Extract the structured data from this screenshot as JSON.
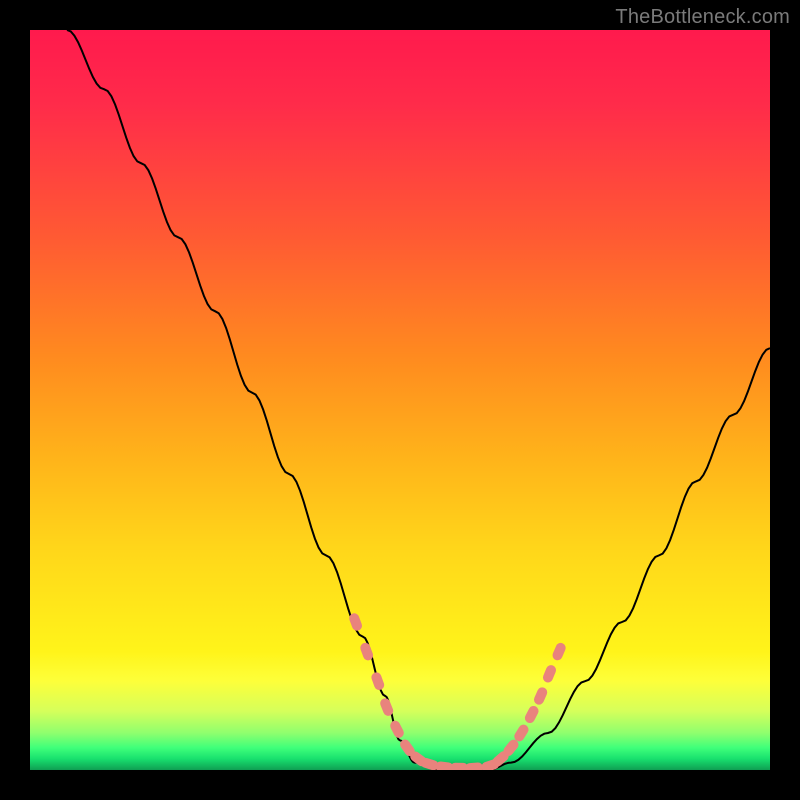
{
  "watermark": "TheBottleneck.com",
  "colors": {
    "background": "#000000",
    "gradient_top": "#ff1a4d",
    "gradient_mid": "#ffd61a",
    "gradient_bottom": "#0f9e52",
    "curve": "#000000",
    "dots": "#e9837d",
    "watermark_text": "#7a7a7a"
  },
  "chart_data": {
    "type": "line",
    "title": "",
    "xlabel": "",
    "ylabel": "",
    "xlim": [
      0,
      100
    ],
    "ylim": [
      0,
      100
    ],
    "series": [
      {
        "name": "bottleneck-curve",
        "x": [
          5,
          10,
          15,
          20,
          25,
          30,
          35,
          40,
          45,
          48,
          50,
          52,
          55,
          58,
          60,
          62,
          65,
          70,
          75,
          80,
          85,
          90,
          95,
          100
        ],
        "values": [
          100,
          92,
          82,
          72,
          62,
          51,
          40,
          29,
          18,
          10,
          4,
          1,
          0,
          0,
          0,
          0,
          1,
          5,
          12,
          20,
          29,
          39,
          48,
          57
        ]
      }
    ],
    "highlight_points": {
      "name": "marker-dots",
      "x": [
        44,
        45.5,
        47,
        48.2,
        49.6,
        51,
        52.5,
        54,
        56,
        58,
        60,
        62.2,
        63.6,
        65,
        66.4,
        67.8,
        69,
        70.2,
        71.5
      ],
      "values": [
        20,
        16,
        12,
        8.5,
        5.5,
        3,
        1.5,
        0.8,
        0.4,
        0.3,
        0.3,
        0.6,
        1.5,
        3,
        5,
        7.5,
        10,
        13,
        16
      ]
    }
  }
}
